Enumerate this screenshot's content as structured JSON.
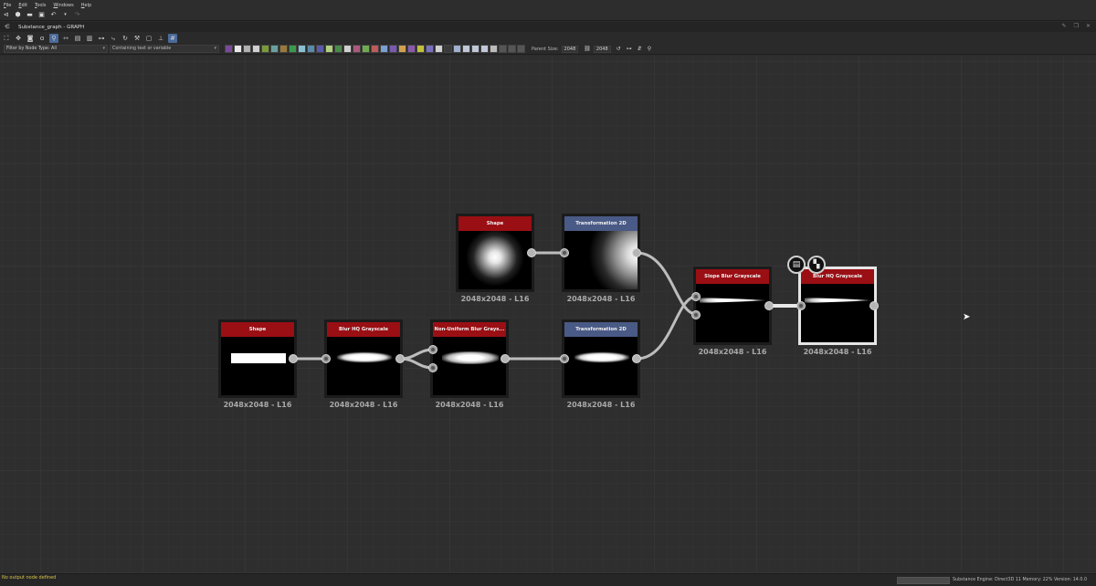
{
  "menu": [
    "File",
    "Edit",
    "Tools",
    "Windows",
    "Help"
  ],
  "graph_tab": {
    "title": "Substance_graph - GRAPH"
  },
  "filter": {
    "node_type_label": "Filter by Node Type:",
    "node_type_value": "All",
    "text_placeholder": "Containing text or variable"
  },
  "parent_size": {
    "label": "Parent Size:",
    "width": "2048",
    "height": "2048"
  },
  "nodes": [
    {
      "id": "shape1",
      "title": "Shape",
      "caption": "2048x2048 - L16"
    },
    {
      "id": "transform1",
      "title": "Transformation 2D",
      "caption": "2048x2048 - L16"
    },
    {
      "id": "shape2",
      "title": "Shape",
      "caption": "2048x2048 - L16"
    },
    {
      "id": "blurhq1",
      "title": "Blur HQ Grayscale",
      "caption": "2048x2048 - L16"
    },
    {
      "id": "nublur",
      "title": "Non-Uniform Blur Grays...",
      "caption": "2048x2048 - L16"
    },
    {
      "id": "transform2",
      "title": "Transformation 2D",
      "caption": "2048x2048 - L16"
    },
    {
      "id": "slopeblur",
      "title": "Slope Blur Grayscale",
      "caption": "2048x2048 - L16"
    },
    {
      "id": "blurhq2",
      "title": "Blur HQ Grayscale",
      "caption": "2048x2048 - L16"
    }
  ],
  "status": {
    "message": "No output node defined",
    "engine": "Substance Engine: Direct3D 11",
    "memory": "Memory: 22%",
    "version": "Version: 14.0.0"
  },
  "colors": {
    "node_header_red": "#9a0f14",
    "node_header_blue": "#4a5a86",
    "status_warning": "#d9c44a"
  }
}
